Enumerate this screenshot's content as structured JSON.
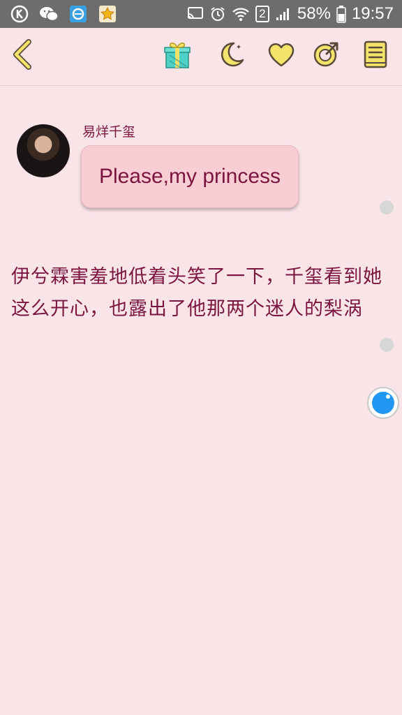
{
  "status_bar": {
    "battery_percent": "58%",
    "time": "19:57",
    "sim_slot": "2",
    "icons": [
      "k-app-icon",
      "wechat-icon",
      "browser-icon",
      "star-app-icon",
      "cast-icon",
      "alarm-icon",
      "wifi-icon",
      "signal-icon",
      "battery-icon"
    ]
  },
  "toolbar": {
    "icons": [
      "back-icon",
      "gift-icon",
      "moon-icon",
      "heart-icon",
      "share-icon",
      "book-icon"
    ],
    "accent": "#f3e36a",
    "outline": "#5a4a3a"
  },
  "chat": {
    "sender_name": "易烊千玺",
    "message": "Please,my princess",
    "narration": "伊兮霖害羞地低着头笑了一下，千玺看到她这么开心，也露出了他那两个迷人的梨涡"
  },
  "colors": {
    "background": "#f9e4e8",
    "text": "#7a1540",
    "bubble": "#f8cdd3",
    "status_bar": "#6d6d6d",
    "float_button": "#2196f3"
  }
}
